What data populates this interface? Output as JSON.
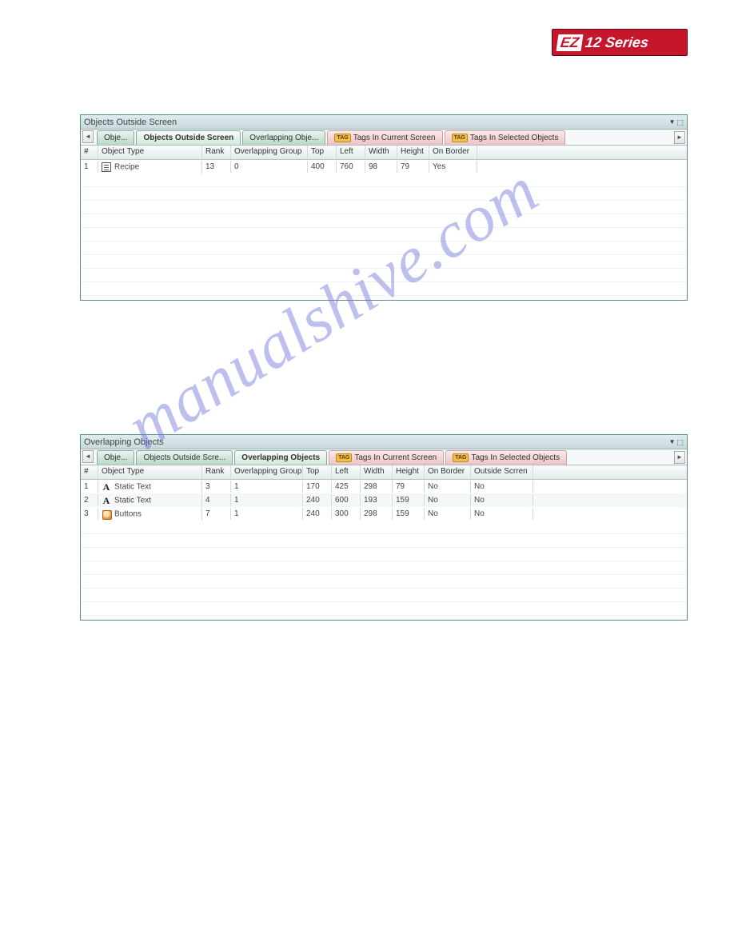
{
  "logo": {
    "ez": "EZ",
    "rest": "12 Series"
  },
  "watermark": "manualshive.com",
  "panel1": {
    "title": "Objects Outside Screen",
    "tabs": [
      {
        "label": "Obje...",
        "kind": "green"
      },
      {
        "label": "Objects Outside Screen",
        "kind": "green-active"
      },
      {
        "label": "Overlapping Obje...",
        "kind": "green"
      },
      {
        "label": "Tags In Current Screen",
        "kind": "pink",
        "badge": "TAG"
      },
      {
        "label": "Tags In Selected Objects",
        "kind": "pink",
        "badge": "TAG"
      }
    ],
    "columns": [
      "#",
      "Object Type",
      "Rank",
      "Overlapping Group",
      "Top",
      "Left",
      "Width",
      "Height",
      "On Border"
    ],
    "rows": [
      {
        "num": "1",
        "icon": "recipe",
        "type": "Recipe",
        "rank": "13",
        "ogrp": "0",
        "top": "400",
        "left": "760",
        "width": "98",
        "height": "79",
        "border": "Yes"
      }
    ]
  },
  "panel2": {
    "title": "Overlapping Objects",
    "tabs": [
      {
        "label": "Obje...",
        "kind": "green"
      },
      {
        "label": "Objects Outside Scre...",
        "kind": "green"
      },
      {
        "label": "Overlapping Objects",
        "kind": "green-active"
      },
      {
        "label": "Tags In Current Screen",
        "kind": "pink",
        "badge": "TAG"
      },
      {
        "label": "Tags In Selected Objects",
        "kind": "pink",
        "badge": "TAG"
      }
    ],
    "columns": [
      "#",
      "Object Type",
      "Rank",
      "Overlapping Group",
      "Top",
      "Left",
      "Width",
      "Height",
      "On Border",
      "Outside Scrren"
    ],
    "rows": [
      {
        "num": "1",
        "icon": "text",
        "iconGlyph": "A",
        "type": "Static Text",
        "rank": "3",
        "ogrp": "1",
        "top": "170",
        "left": "425",
        "width": "298",
        "height": "79",
        "border": "No",
        "outside": "No"
      },
      {
        "num": "2",
        "icon": "text",
        "iconGlyph": "A",
        "type": "Static Text",
        "rank": "4",
        "ogrp": "1",
        "top": "240",
        "left": "600",
        "width": "193",
        "height": "159",
        "border": "No",
        "outside": "No"
      },
      {
        "num": "3",
        "icon": "button",
        "type": "Buttons",
        "rank": "7",
        "ogrp": "1",
        "top": "240",
        "left": "300",
        "width": "298",
        "height": "159",
        "border": "No",
        "outside": "No"
      }
    ]
  }
}
